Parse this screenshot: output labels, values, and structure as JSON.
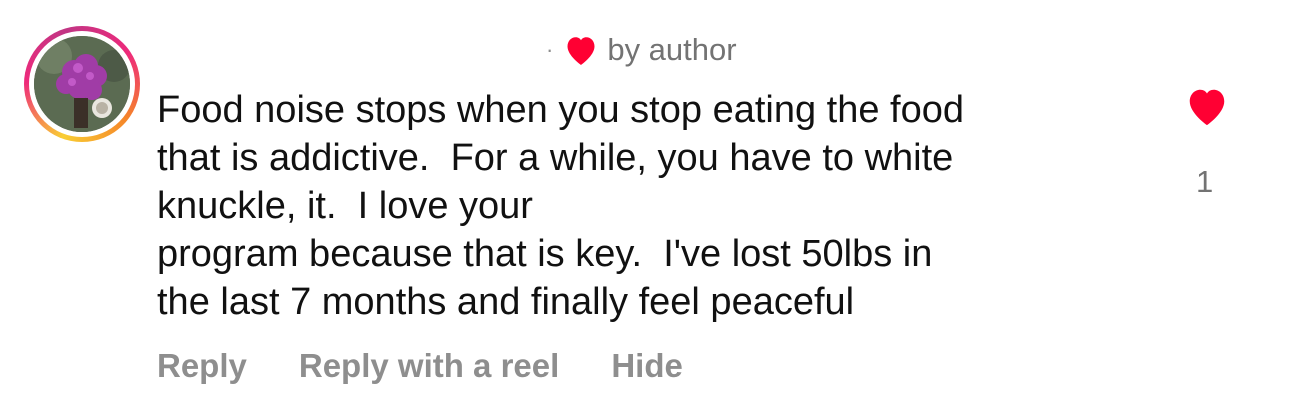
{
  "comment": {
    "meta": {
      "separator": "·",
      "liked_label": "by author",
      "heart_icon": "heart-icon",
      "heart_color": "#ff0033"
    },
    "lines": [
      "Food noise stops when you stop eating the food",
      "that is addictive.  For a while, you have to white",
      "knuckle, it.  I love your",
      "program because that is key.  I've lost 50lbs in",
      "the last 7 months and finally feel peaceful"
    ],
    "like": {
      "icon": "heart-filled-icon",
      "color": "#ff0033",
      "count": "1"
    },
    "actions": {
      "reply": "Reply",
      "reply_reel": "Reply with a reel",
      "hide": "Hide"
    },
    "avatar": {
      "ring_colors": [
        "#f9ce34",
        "#ee2a7b",
        "#c13584",
        "#f58529"
      ]
    }
  }
}
